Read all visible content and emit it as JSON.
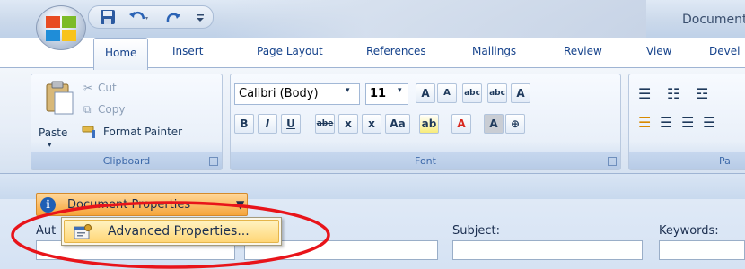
{
  "window": {
    "title": "Document"
  },
  "quick_access": {
    "items": [
      "save-icon",
      "undo-icon",
      "redo-icon",
      "customize-icon"
    ]
  },
  "tabs": [
    {
      "label": "Home",
      "active": true
    },
    {
      "label": "Insert"
    },
    {
      "label": "Page Layout"
    },
    {
      "label": "References"
    },
    {
      "label": "Mailings"
    },
    {
      "label": "Review"
    },
    {
      "label": "View"
    },
    {
      "label": "Devel"
    }
  ],
  "clipboard": {
    "paste_label": "Paste",
    "cut_label": "Cut",
    "copy_label": "Copy",
    "format_painter_label": "Format Painter",
    "caption": "Clipboard"
  },
  "font": {
    "font_name": "Calibri (Body)",
    "font_size": "11",
    "caption": "Font",
    "buttons": [
      "A",
      "A",
      "abc",
      "A"
    ],
    "format_buttons": [
      "B",
      "I",
      "U",
      "abe",
      "x",
      "x",
      "Aa",
      "ab",
      "A",
      "A"
    ]
  },
  "paragraph": {
    "caption": "Pa"
  },
  "document_panel": {
    "properties_button": "Document Properties",
    "menu_item": "Advanced Properties...",
    "fields": [
      {
        "label": "Aut"
      },
      {
        "label": "Subject:"
      },
      {
        "label": "Keywords:"
      }
    ]
  },
  "colors": {
    "accent_orange": "#f6a53a",
    "ribbon_blue": "#dfe9f5",
    "highlight_red": "#e8141a",
    "info_blue": "#1f5fb5"
  }
}
